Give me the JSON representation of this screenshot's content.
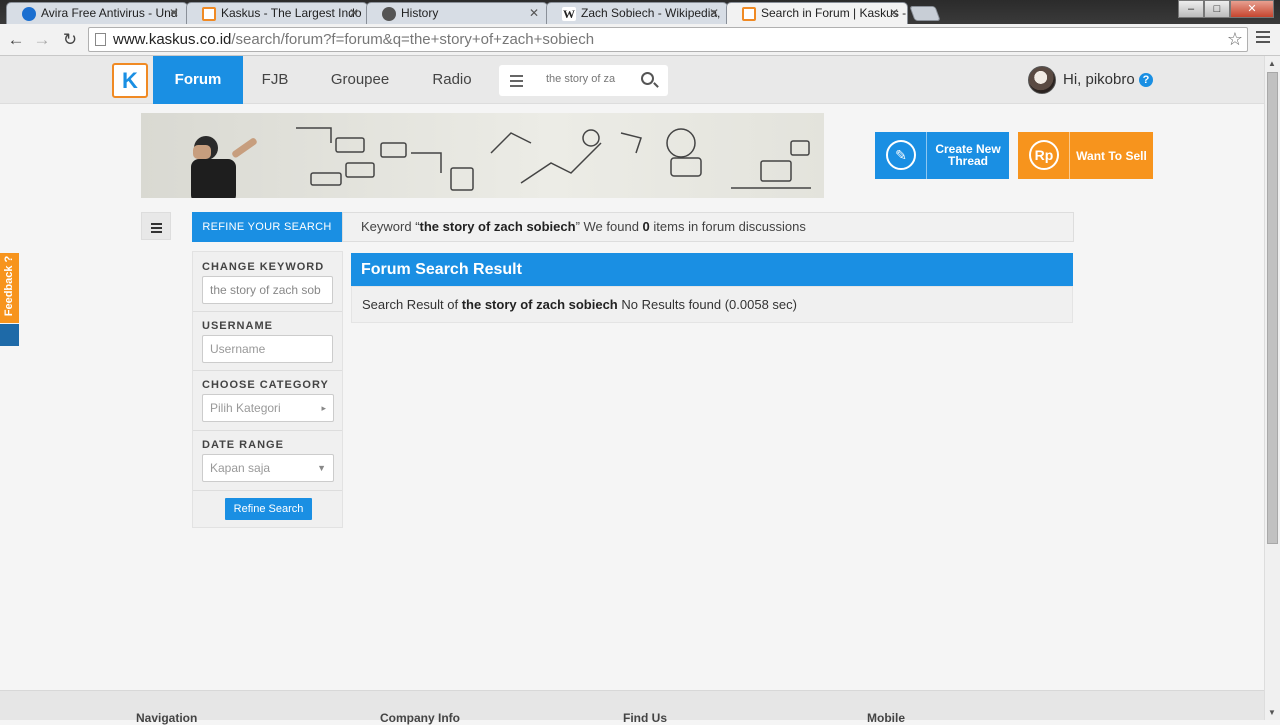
{
  "browser": {
    "tabs": [
      {
        "title": "Avira Free Antivirus - Und",
        "favicon_color": "#1b6fd0"
      },
      {
        "title": "Kaskus - The Largest Indo",
        "favicon_color": "#f08a24"
      },
      {
        "title": "History",
        "favicon_color": "#555555"
      },
      {
        "title": "Zach Sobiech - Wikipedia,",
        "favicon_color": "#333333"
      },
      {
        "title": "Search in Forum | Kaskus -",
        "favicon_color": "#f08a24"
      }
    ],
    "url_host": "www.kaskus.co.id",
    "url_path": "/search/forum?f=forum&q=the+story+of+zach+sobiech",
    "window_buttons": {
      "minimize": "–",
      "maximize": "□",
      "close": "✕"
    }
  },
  "header": {
    "logo": "K",
    "nav": [
      {
        "label": "Forum",
        "active": true
      },
      {
        "label": "FJB",
        "active": false
      },
      {
        "label": "Groupee",
        "active": false
      },
      {
        "label": "Radio",
        "active": false
      }
    ],
    "search_value": "the story of za",
    "greeting": "Hi, pikobro",
    "help": "?"
  },
  "actions": {
    "create_thread": "Create New Thread",
    "create_icon": "✎",
    "want_to_sell": "Want To Sell",
    "sell_icon": "Rp"
  },
  "feedback": "Feedback ?",
  "search": {
    "refine_tab": "REFINE YOUR SEARCH",
    "keyword_prefix": "Keyword “",
    "keyword": "the story of zach sobiech",
    "keyword_mid": "” We found ",
    "count": "0",
    "keyword_suffix": " items in forum discussions"
  },
  "sidebar": {
    "change_keyword_label": "CHANGE KEYWORD",
    "change_keyword_value": "the story of zach sob",
    "username_label": "USERNAME",
    "username_placeholder": "Username",
    "category_label": "CHOOSE CATEGORY",
    "category_placeholder": "Pilih Kategori",
    "date_label": "DATE RANGE",
    "date_value": "Kapan saja",
    "refine_button": "Refine Search"
  },
  "result": {
    "title": "Forum Search Result",
    "prefix": "Search Result of ",
    "query": "the story of zach sobiech",
    "suffix": " No Results found (0.0058 sec)"
  },
  "footer": {
    "headings": [
      "Navigation",
      "Company Info",
      "Find Us",
      "Mobile"
    ]
  },
  "colors": {
    "accent_blue": "#1a8fe3",
    "accent_orange": "#f7941d"
  }
}
